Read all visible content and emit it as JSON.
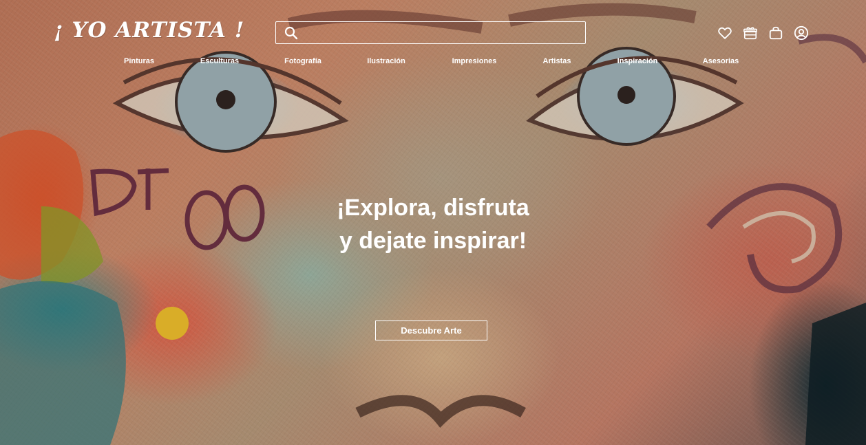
{
  "brand": {
    "logo_text": "¡ YO ARTISTA !"
  },
  "search": {
    "placeholder": "",
    "value": "",
    "icon": "search-icon"
  },
  "header_icons": [
    {
      "name": "heart-icon",
      "label": "Favoritos"
    },
    {
      "name": "gift-icon",
      "label": "Regalos"
    },
    {
      "name": "shopping-bag-icon",
      "label": "Carrito"
    },
    {
      "name": "user-icon",
      "label": "Cuenta"
    }
  ],
  "nav": {
    "items": [
      {
        "label": "Pinturas"
      },
      {
        "label": "Esculturas"
      },
      {
        "label": "Fotografía"
      },
      {
        "label": "Ilustración"
      },
      {
        "label": "Impresiones"
      },
      {
        "label": "Artistas"
      },
      {
        "label": "Inspiración"
      },
      {
        "label": "Asesorias"
      }
    ]
  },
  "hero": {
    "title_line1": "¡Explora, disfruta",
    "title_line2": "y dejate inspirar!",
    "cta_label": "Descubre Arte"
  },
  "colors": {
    "text": "#ffffff",
    "accent_outline": "#ffffff"
  }
}
